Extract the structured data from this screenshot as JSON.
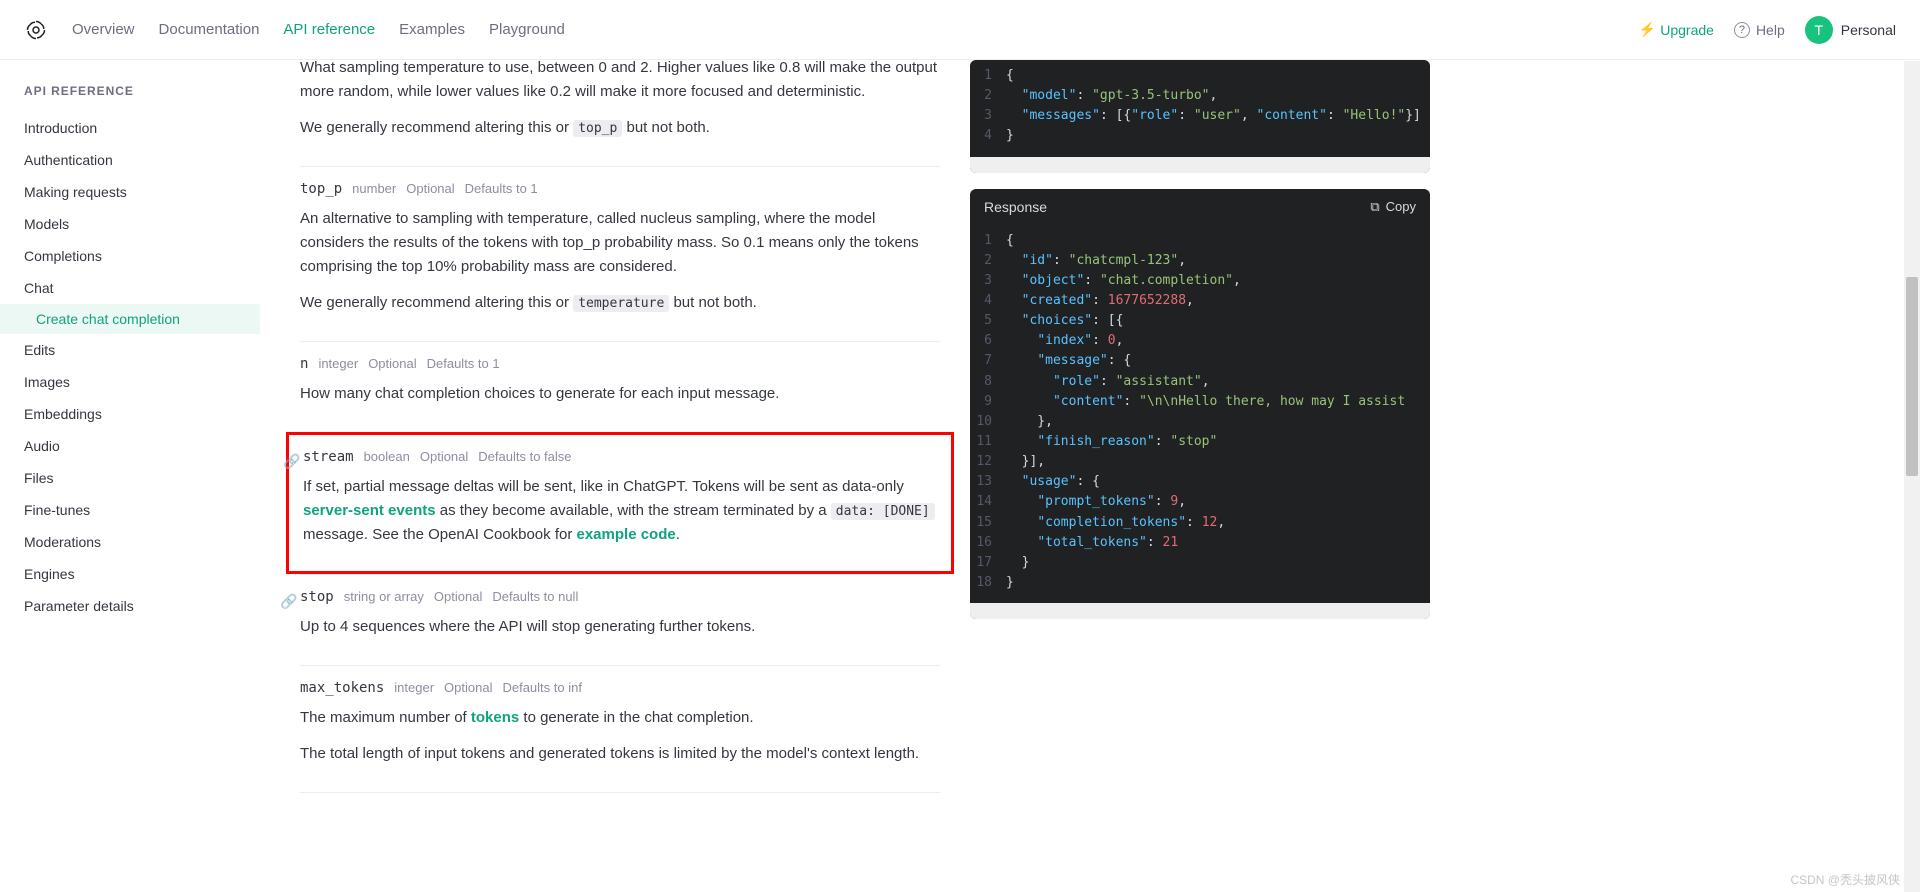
{
  "header": {
    "nav": [
      "Overview",
      "Documentation",
      "API reference",
      "Examples",
      "Playground"
    ],
    "active_nav": 2,
    "upgrade": "Upgrade",
    "help": "Help",
    "avatar_initial": "T",
    "account": "Personal"
  },
  "sidebar": {
    "title": "API REFERENCE",
    "items": [
      "Introduction",
      "Authentication",
      "Making requests",
      "Models",
      "Completions",
      "Chat",
      "Edits",
      "Images",
      "Embeddings",
      "Audio",
      "Files",
      "Fine-tunes",
      "Moderations",
      "Engines",
      "Parameter details"
    ],
    "subitems": {
      "5": [
        "Create chat completion"
      ]
    }
  },
  "params": {
    "temperature": {
      "desc1": "What sampling temperature to use, between 0 and 2. Higher values like 0.8 will make the output more random, while lower values like 0.2 will make it more focused and deterministic.",
      "desc2_pre": "We generally recommend altering this or ",
      "desc2_code": "top_p",
      "desc2_post": " but not both."
    },
    "top_p": {
      "name": "top_p",
      "type": "number",
      "opt": "Optional",
      "default": "Defaults to 1",
      "desc1": "An alternative to sampling with temperature, called nucleus sampling, where the model considers the results of the tokens with top_p probability mass. So 0.1 means only the tokens comprising the top 10% probability mass are considered.",
      "desc2_pre": "We generally recommend altering this or ",
      "desc2_code": "temperature",
      "desc2_post": " but not both."
    },
    "n": {
      "name": "n",
      "type": "integer",
      "opt": "Optional",
      "default": "Defaults to 1",
      "desc1": "How many chat completion choices to generate for each input message."
    },
    "stream": {
      "name": "stream",
      "type": "boolean",
      "opt": "Optional",
      "default": "Defaults to false",
      "desc1_pre": "If set, partial message deltas will be sent, like in ChatGPT. Tokens will be sent as data-only ",
      "desc1_link1": "server-sent events",
      "desc1_mid": " as they become available, with the stream terminated by a ",
      "desc1_code": "data: [DONE]",
      "desc1_post": " message. See the OpenAI Cookbook for ",
      "desc1_link2": "example code",
      "desc1_end": "."
    },
    "stop": {
      "name": "stop",
      "type": "string or array",
      "opt": "Optional",
      "default": "Defaults to null",
      "desc1": "Up to 4 sequences where the API will stop generating further tokens."
    },
    "max_tokens": {
      "name": "max_tokens",
      "type": "integer",
      "opt": "Optional",
      "default": "Defaults to inf",
      "desc1_pre": "The maximum number of ",
      "desc1_link": "tokens",
      "desc1_post": " to generate in the chat completion.",
      "desc2": "The total length of input tokens and generated tokens is limited by the model's context length."
    }
  },
  "request_panel": {
    "lines": [
      {
        "n": "1",
        "tokens": [
          {
            "t": "{",
            "c": "punc"
          }
        ]
      },
      {
        "n": "2",
        "tokens": [
          {
            "t": "  ",
            "c": "punc"
          },
          {
            "t": "\"model\"",
            "c": "key"
          },
          {
            "t": ": ",
            "c": "punc"
          },
          {
            "t": "\"gpt-3.5-turbo\"",
            "c": "str"
          },
          {
            "t": ",",
            "c": "punc"
          }
        ]
      },
      {
        "n": "3",
        "tokens": [
          {
            "t": "  ",
            "c": "punc"
          },
          {
            "t": "\"messages\"",
            "c": "key"
          },
          {
            "t": ": [{",
            "c": "punc"
          },
          {
            "t": "\"role\"",
            "c": "key"
          },
          {
            "t": ": ",
            "c": "punc"
          },
          {
            "t": "\"user\"",
            "c": "str"
          },
          {
            "t": ", ",
            "c": "punc"
          },
          {
            "t": "\"content\"",
            "c": "key"
          },
          {
            "t": ": ",
            "c": "punc"
          },
          {
            "t": "\"Hello!\"",
            "c": "str"
          },
          {
            "t": "}]",
            "c": "punc"
          }
        ]
      },
      {
        "n": "4",
        "tokens": [
          {
            "t": "}",
            "c": "punc"
          }
        ]
      }
    ]
  },
  "response_panel": {
    "title": "Response",
    "copy": "Copy",
    "lines": [
      {
        "n": "1",
        "tokens": [
          {
            "t": "{",
            "c": "punc"
          }
        ]
      },
      {
        "n": "2",
        "tokens": [
          {
            "t": "  ",
            "c": "punc"
          },
          {
            "t": "\"id\"",
            "c": "key"
          },
          {
            "t": ": ",
            "c": "punc"
          },
          {
            "t": "\"chatcmpl-123\"",
            "c": "str"
          },
          {
            "t": ",",
            "c": "punc"
          }
        ]
      },
      {
        "n": "3",
        "tokens": [
          {
            "t": "  ",
            "c": "punc"
          },
          {
            "t": "\"object\"",
            "c": "key"
          },
          {
            "t": ": ",
            "c": "punc"
          },
          {
            "t": "\"chat.completion\"",
            "c": "str"
          },
          {
            "t": ",",
            "c": "punc"
          }
        ]
      },
      {
        "n": "4",
        "tokens": [
          {
            "t": "  ",
            "c": "punc"
          },
          {
            "t": "\"created\"",
            "c": "key"
          },
          {
            "t": ": ",
            "c": "punc"
          },
          {
            "t": "1677652288",
            "c": "num"
          },
          {
            "t": ",",
            "c": "punc"
          }
        ]
      },
      {
        "n": "5",
        "tokens": [
          {
            "t": "  ",
            "c": "punc"
          },
          {
            "t": "\"choices\"",
            "c": "key"
          },
          {
            "t": ": [{",
            "c": "punc"
          }
        ]
      },
      {
        "n": "6",
        "tokens": [
          {
            "t": "    ",
            "c": "punc"
          },
          {
            "t": "\"index\"",
            "c": "key"
          },
          {
            "t": ": ",
            "c": "punc"
          },
          {
            "t": "0",
            "c": "num"
          },
          {
            "t": ",",
            "c": "punc"
          }
        ]
      },
      {
        "n": "7",
        "tokens": [
          {
            "t": "    ",
            "c": "punc"
          },
          {
            "t": "\"message\"",
            "c": "key"
          },
          {
            "t": ": {",
            "c": "punc"
          }
        ]
      },
      {
        "n": "8",
        "tokens": [
          {
            "t": "      ",
            "c": "punc"
          },
          {
            "t": "\"role\"",
            "c": "key"
          },
          {
            "t": ": ",
            "c": "punc"
          },
          {
            "t": "\"assistant\"",
            "c": "str"
          },
          {
            "t": ",",
            "c": "punc"
          }
        ]
      },
      {
        "n": "9",
        "tokens": [
          {
            "t": "      ",
            "c": "punc"
          },
          {
            "t": "\"content\"",
            "c": "key"
          },
          {
            "t": ": ",
            "c": "punc"
          },
          {
            "t": "\"\\n\\nHello there, how may I assist",
            "c": "str"
          }
        ]
      },
      {
        "n": "10",
        "tokens": [
          {
            "t": "    },",
            "c": "punc"
          }
        ]
      },
      {
        "n": "11",
        "tokens": [
          {
            "t": "    ",
            "c": "punc"
          },
          {
            "t": "\"finish_reason\"",
            "c": "key"
          },
          {
            "t": ": ",
            "c": "punc"
          },
          {
            "t": "\"stop\"",
            "c": "str"
          }
        ]
      },
      {
        "n": "12",
        "tokens": [
          {
            "t": "  }],",
            "c": "punc"
          }
        ]
      },
      {
        "n": "13",
        "tokens": [
          {
            "t": "  ",
            "c": "punc"
          },
          {
            "t": "\"usage\"",
            "c": "key"
          },
          {
            "t": ": {",
            "c": "punc"
          }
        ]
      },
      {
        "n": "14",
        "tokens": [
          {
            "t": "    ",
            "c": "punc"
          },
          {
            "t": "\"prompt_tokens\"",
            "c": "key"
          },
          {
            "t": ": ",
            "c": "punc"
          },
          {
            "t": "9",
            "c": "num"
          },
          {
            "t": ",",
            "c": "punc"
          }
        ]
      },
      {
        "n": "15",
        "tokens": [
          {
            "t": "    ",
            "c": "punc"
          },
          {
            "t": "\"completion_tokens\"",
            "c": "key"
          },
          {
            "t": ": ",
            "c": "punc"
          },
          {
            "t": "12",
            "c": "num"
          },
          {
            "t": ",",
            "c": "punc"
          }
        ]
      },
      {
        "n": "16",
        "tokens": [
          {
            "t": "    ",
            "c": "punc"
          },
          {
            "t": "\"total_tokens\"",
            "c": "key"
          },
          {
            "t": ": ",
            "c": "punc"
          },
          {
            "t": "21",
            "c": "num"
          }
        ]
      },
      {
        "n": "17",
        "tokens": [
          {
            "t": "  }",
            "c": "punc"
          }
        ]
      },
      {
        "n": "18",
        "tokens": [
          {
            "t": "}",
            "c": "punc"
          }
        ]
      }
    ]
  },
  "watermark": "CSDN @秃头披风侠"
}
